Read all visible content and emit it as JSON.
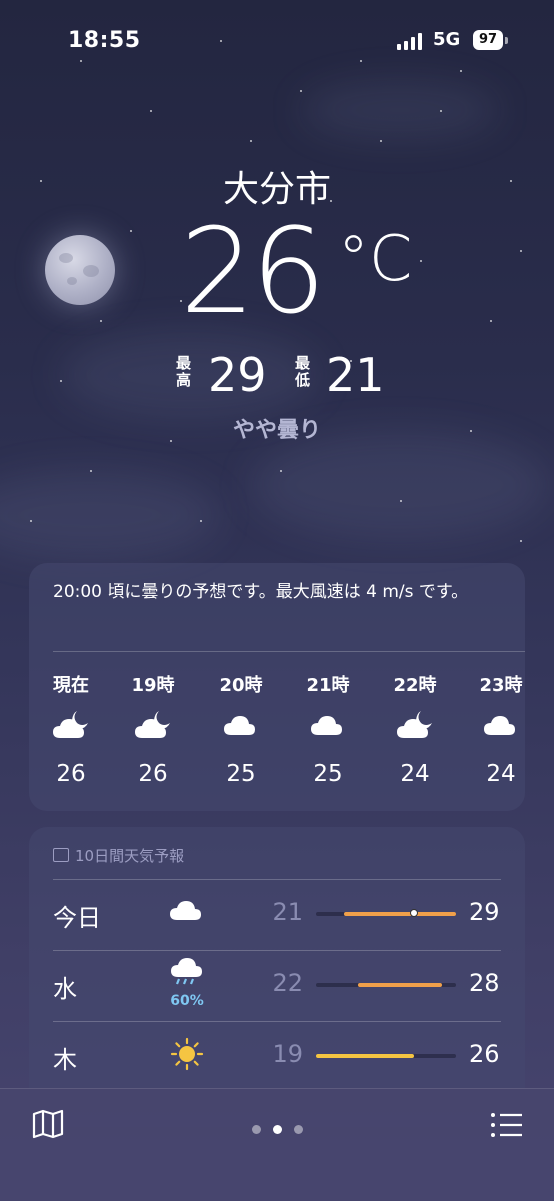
{
  "status_bar": {
    "time": "18:55",
    "network": "5G",
    "battery": "97"
  },
  "location": {
    "city": "大分市",
    "temperature": "26",
    "unit": "°C",
    "high_label": "最高",
    "high": "29",
    "low_label": "最低",
    "low": "21",
    "condition": "やや曇り"
  },
  "hourly": {
    "summary": "20:00 頃に曇りの予想です。最大風速は 4 m/s です。",
    "items": [
      {
        "label": "現在",
        "icon": "partly-cloudy-night-icon",
        "temp": "26"
      },
      {
        "label": "19時",
        "icon": "partly-cloudy-night-icon",
        "temp": "26"
      },
      {
        "label": "20時",
        "icon": "cloud-icon",
        "temp": "25"
      },
      {
        "label": "21時",
        "icon": "cloud-icon",
        "temp": "25"
      },
      {
        "label": "22時",
        "icon": "partly-cloudy-night-icon",
        "temp": "24"
      },
      {
        "label": "23時",
        "icon": "cloud-icon",
        "temp": "24"
      }
    ]
  },
  "daily": {
    "header": "10日間天気予報",
    "range_min": 19,
    "range_max": 29,
    "rows": [
      {
        "day": "今日",
        "icon": "cloud-icon",
        "pop": "",
        "low": "21",
        "high": "29",
        "bar_from": 21,
        "bar_to": 29,
        "current": 26
      },
      {
        "day": "水",
        "icon": "rain-cloud-icon",
        "pop": "60%",
        "low": "22",
        "high": "28",
        "bar_from": 22,
        "bar_to": 28
      },
      {
        "day": "木",
        "icon": "sun-icon",
        "pop": "",
        "low": "19",
        "high": "26",
        "bar_from": 19,
        "bar_to": 26
      }
    ]
  },
  "colors": {
    "bar_warm": "#f0a04a",
    "bar_yellow": "#f5c542",
    "pop_blue": "#7fc7f2"
  },
  "bottom_bar": {
    "pages": 3,
    "current_page": 2
  }
}
